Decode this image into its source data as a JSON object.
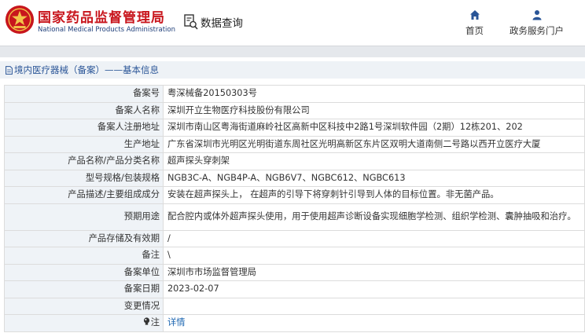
{
  "header": {
    "brand_cn": "国家药品监督管理局",
    "brand_en": "National Medical Products Administration",
    "query_label": "数据查询",
    "nav": {
      "home": "首页",
      "gov": "政务服务门户"
    }
  },
  "breadcrumb": "境内医疗器械（备案）——基本信息",
  "rows": [
    {
      "key": "备案号",
      "value": "粤深械备20150303号"
    },
    {
      "key": "备案人名称",
      "value": "深圳开立生物医疗科技股份有限公司"
    },
    {
      "key": "备案人注册地址",
      "value": "深圳市南山区粤海街道麻岭社区高新中区科技中2路1号深圳软件园（2期）12栋201、202"
    },
    {
      "key": "生产地址",
      "value": "广东省深圳市光明区光明街道东周社区光明高新区东片区双明大道南侧二号路以西开立医疗大厦"
    },
    {
      "key": "产品名称/产品分类名称",
      "value": "超声探头穿刺架"
    },
    {
      "key": "型号规格/包装规格",
      "value": "NGB3C-A、NGB4P-A、NGB6V7、NGBC612、NGBC613"
    },
    {
      "key": "产品描述/主要组成成分",
      "value": "安装在超声探头上， 在超声的引导下将穿刺针引导到人体的目标位置。非无菌产品。"
    },
    {
      "key": "预期用途",
      "value": "配合腔内或体外超声探头使用，用于使用超声诊断设备实现细胞学检测、组织学检测、囊肿抽吸和治疗。"
    },
    {
      "key": "产品存储及有效期",
      "value": "/"
    },
    {
      "key": "备注",
      "value": "\\"
    },
    {
      "key": "备案单位",
      "value": "深圳市市场监督管理局"
    },
    {
      "key": "备案日期",
      "value": "2023-02-07"
    },
    {
      "key": "变更情况",
      "value": ""
    },
    {
      "key": "注",
      "value": "详情"
    }
  ],
  "colors": {
    "brand_red": "#c8161d",
    "nav_blue": "#2a5597",
    "link": "#1a64b0",
    "label_bg": "#eff3f7"
  },
  "icons": {
    "logo": "nmpa-emblem",
    "query": "search-doc-icon",
    "home": "home-icon",
    "gov": "user-icon",
    "crumb": "document-icon",
    "note": "lightbulb-icon"
  }
}
